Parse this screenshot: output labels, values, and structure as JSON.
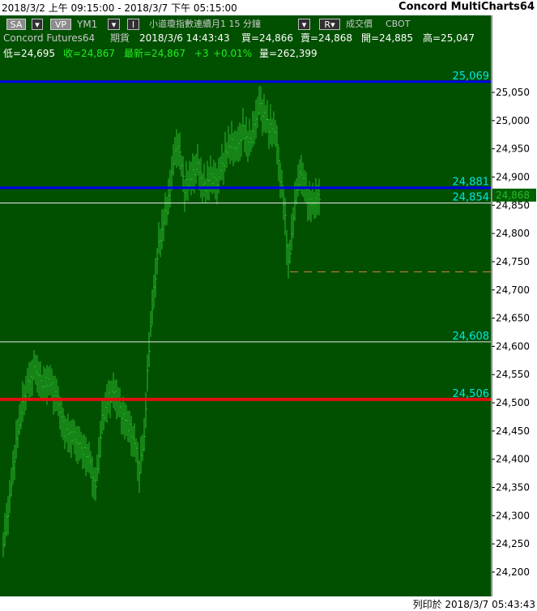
{
  "window": {
    "date_range": "2018/3/2 上午 09:15:00 - 2018/3/7 下午 05:15:00",
    "app_title": "Concord MultiCharts64"
  },
  "toolbar": {
    "sa_label": "SA",
    "vp_label": "VP",
    "symbol": "YM1",
    "i_label": "I",
    "description": "小道瓊指數連續月1  15 分鐘",
    "quote_type": "成交價",
    "exchange": "CBOT",
    "r_label": "R",
    "dropdown_arrow": "▾",
    "check_mark": "✓"
  },
  "quote_line1": {
    "source": "Concord Futures64",
    "category": "期貨",
    "datetime": "2018/3/6  14:43:43",
    "bid": "買=24,866",
    "ask": "賣=24,868",
    "open": "開=24,885",
    "high": "高=25,047"
  },
  "quote_line2": {
    "low": "低=24,695",
    "close": "收=24,867",
    "last": "最新=24,867",
    "change": "+3",
    "change_pct": "+0.01%",
    "volume": "量=262,399"
  },
  "price_axis": {
    "ticks": [
      "25,050",
      "25,000",
      "24,950",
      "24,900",
      "24,850",
      "24,800",
      "24,750",
      "24,700",
      "24,650",
      "24,600",
      "24,550",
      "24,500",
      "24,450",
      "24,400",
      "24,350",
      "24,300",
      "24,250",
      "24,200"
    ],
    "current_price": "24,868"
  },
  "levels": [
    {
      "label": "25,069",
      "value": 25069,
      "color": "#0000e6",
      "width": 3
    },
    {
      "label": "24,881",
      "value": 24881,
      "color": "#0000e6",
      "width": 3
    },
    {
      "label": "24,854",
      "value": 24854,
      "color": "#e8e8e8",
      "width": 1
    },
    {
      "label": "24,608",
      "value": 24608,
      "color": "#e8e8e8",
      "width": 1
    },
    {
      "label": "24,506",
      "value": 24506,
      "color": "#e01010",
      "width": 4
    }
  ],
  "dashed_level": {
    "value": 24732,
    "color": "#d08040"
  },
  "colors": {
    "plot_background": "#005000",
    "bars": "#2db82d",
    "level_label": "#00e5e5",
    "quote_text": "#ffffff",
    "quote_green": "#22ee22"
  },
  "footer": {
    "printed_at": "列印於 2018/3/7 05:43:43"
  }
}
